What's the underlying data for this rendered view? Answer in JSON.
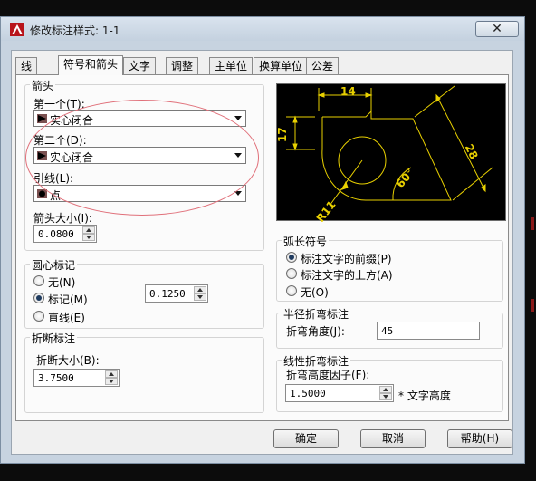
{
  "window": {
    "title": "修改标注样式: 1-1",
    "close_symbol": "✕"
  },
  "tabs": [
    {
      "label": "线"
    },
    {
      "label": "符号和箭头"
    },
    {
      "label": "文字"
    },
    {
      "label": "调整"
    },
    {
      "label": "主单位"
    },
    {
      "label": "换算单位"
    },
    {
      "label": "公差"
    }
  ],
  "arrowheads": {
    "group_label": "箭头",
    "first_label": "第一个(T):",
    "first_value": "实心闭合",
    "second_label": "第二个(D):",
    "second_value": "实心闭合",
    "leader_label": "引线(L):",
    "leader_value": "点",
    "size_label": "箭头大小(I):",
    "size_value": "0.0800"
  },
  "center_marks": {
    "group_label": "圆心标记",
    "none_label": "无(N)",
    "mark_label": "标记(M)",
    "line_label": "直线(E)",
    "selected": "mark",
    "size_value": "0.1250"
  },
  "break": {
    "group_label": "折断标注",
    "size_label": "折断大小(B):",
    "size_value": "3.7500"
  },
  "preview": {
    "dim_14": "14",
    "dim_17": "17",
    "dim_28": "28",
    "dim_60": "60°",
    "dim_r11": "R11",
    "line_color": "#e8d000"
  },
  "arc_length": {
    "group_label": "弧长符号",
    "prefix_label": "标注文字的前缀(P)",
    "above_label": "标注文字的上方(A)",
    "none_label": "无(O)",
    "selected": "prefix"
  },
  "radius_jog": {
    "group_label": "半径折弯标注",
    "angle_label": "折弯角度(J):",
    "angle_value": "45"
  },
  "linear_jog": {
    "group_label": "线性折弯标注",
    "factor_label": "折弯高度因子(F):",
    "factor_value": "1.5000",
    "factor_suffix": "* 文字高度"
  },
  "buttons": {
    "ok": "确定",
    "cancel": "取消",
    "help": "帮助(H)"
  },
  "colors": {
    "annotation_ellipse": "#e0707a",
    "preview_background": "#000000"
  }
}
